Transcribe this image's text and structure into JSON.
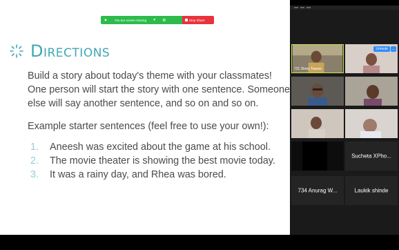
{
  "share_bar": {
    "status": "You are screen sharing",
    "stop_label": "Stop Share"
  },
  "slide": {
    "title": "Directions",
    "intro": "Build a story about today's theme with your classmates! One person will start the story with one sentence. Someone else will say another sentence, and so on and so on.",
    "example_label": "Example starter sentences (feel free to use your own!):",
    "sentences": [
      {
        "num": "1.",
        "text": "Aneesh was excited about the game at his school."
      },
      {
        "num": "2.",
        "text": "The movie theater is showing the best movie today."
      },
      {
        "num": "3.",
        "text": "It was a rainy day, and Rhea was bored."
      }
    ]
  },
  "participants": {
    "tile1_name": "731 Shrey Taware",
    "tile2_unmute": "Unmute",
    "tile2_more": "...",
    "tile8_name": "Sucheta XPho...",
    "tile9_name": "734 Anurag W...",
    "tile10_name": "Laukik shinde"
  },
  "colors": {
    "accent": "#3fa7b6",
    "share_green": "#2dbb4c",
    "stop_red": "#e8333c",
    "unmute_blue": "#2d8cff",
    "active_speaker": "#c8e64a"
  }
}
